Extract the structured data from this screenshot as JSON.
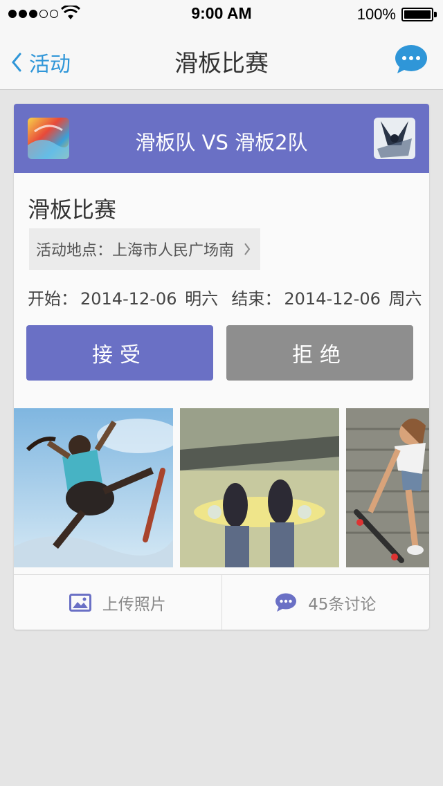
{
  "status_bar": {
    "time": "9:00 AM",
    "battery": "100%",
    "signal_bars_filled": 3,
    "signal_bars_total": 5
  },
  "nav": {
    "back_label": "活动",
    "title": "滑板比赛",
    "accent_color": "#2f96d8"
  },
  "card": {
    "header_color": "#6a70c5",
    "match_title": "滑板队 VS 滑板2队",
    "event_title": "滑板比赛",
    "location_label": "活动地点：上海市人民广场南",
    "start_label": "开始：",
    "start_date": "2014-12-06",
    "start_weekday": "明六",
    "end_label": "结束：",
    "end_date": "2014-12-06",
    "end_weekday": "周六",
    "accept_label": "接受",
    "reject_label": "拒绝",
    "upload_label": "上传照片",
    "discussion_label": "45条讨论"
  }
}
